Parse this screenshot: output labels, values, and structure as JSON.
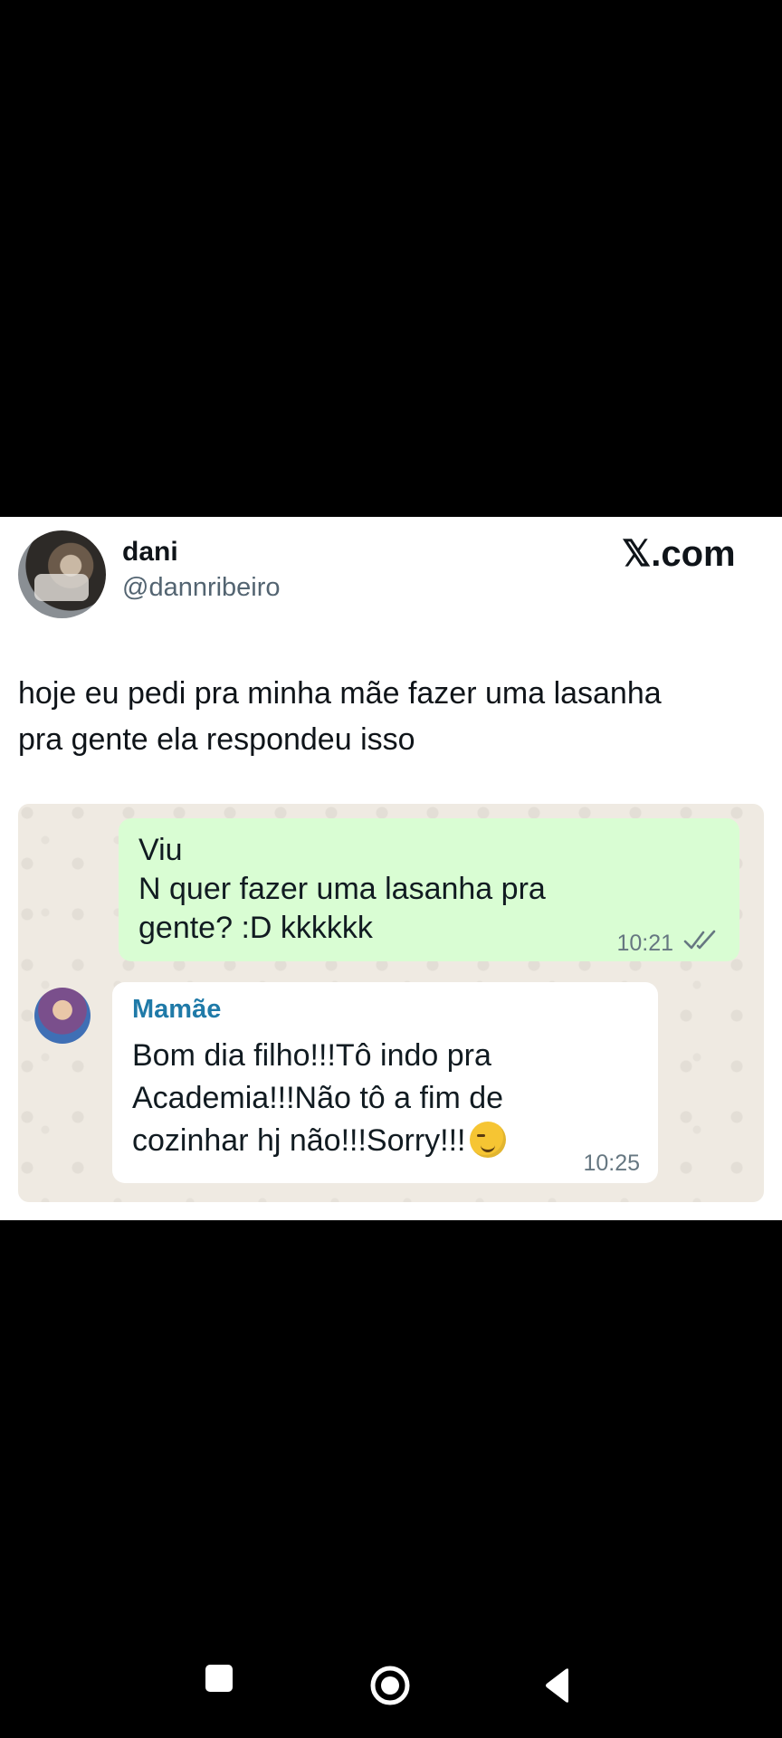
{
  "tweet": {
    "author_name": "dani",
    "author_handle": "@dannribeiro",
    "brand": "𝕏.com",
    "text_lines": [
      "hoje eu pedi pra minha mãe fazer uma lasanha",
      "pra gente ela respondeu isso"
    ]
  },
  "chat": {
    "outgoing": {
      "lines": [
        "Viu",
        "N quer fazer uma lasanha pra",
        "gente? :D kkkkkk"
      ],
      "time": "10:21",
      "status_icon": "double-check-icon"
    },
    "incoming": {
      "sender": "Mamãe",
      "lines": [
        "Bom dia filho!!!Tô indo pra",
        "Academia!!!Não tô a fim de",
        "cozinhar hj não!!!Sorry!!!"
      ],
      "emoji": "smirking-face-emoji",
      "time": "10:25"
    }
  },
  "colors": {
    "outgoing_bubble": "#d9fdd3",
    "incoming_bubble": "#ffffff",
    "chat_background": "#efeae2",
    "sender_name": "#1f7aa8"
  },
  "system_nav": {
    "icons": [
      "recents-icon",
      "home-icon",
      "back-icon"
    ]
  }
}
